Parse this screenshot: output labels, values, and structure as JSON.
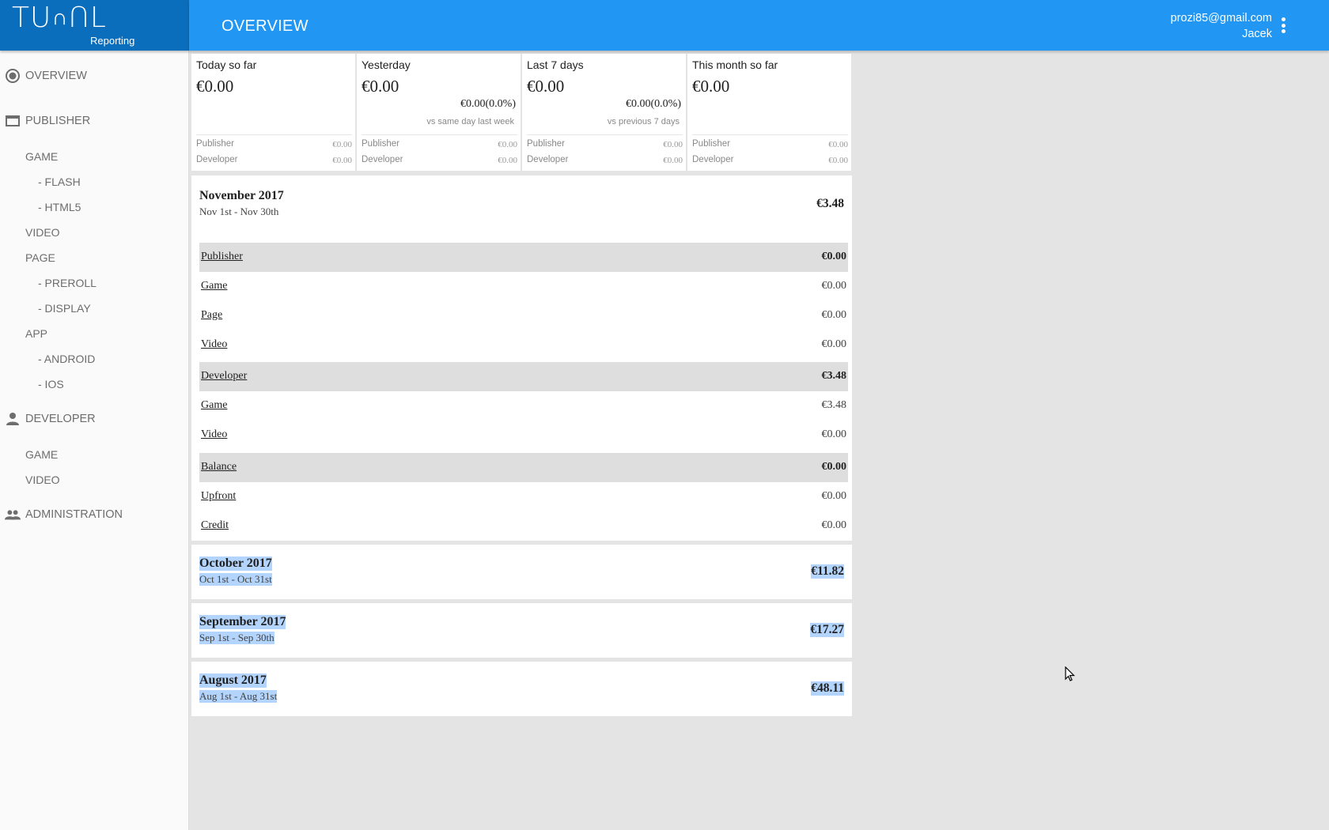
{
  "brand": {
    "logo": "TUՈՈL",
    "sub": "Reporting",
    "header_color": "#0a6ebd",
    "accent": "#2196f3"
  },
  "header": {
    "title": "OVERVIEW",
    "email": "prozi85@gmail.com",
    "user": "Jacek",
    "menu_icon": "more-vert-icon"
  },
  "sidebar": {
    "items": [
      {
        "label": "OVERVIEW",
        "icon": "radio-button-checked-icon",
        "level": 0
      },
      {
        "label": "PUBLISHER",
        "icon": "web-asset-icon",
        "level": 0
      },
      {
        "label": "GAME",
        "level": 1
      },
      {
        "label": "- FLASH",
        "level": 2
      },
      {
        "label": "- HTML5",
        "level": 2
      },
      {
        "label": "VIDEO",
        "level": 1
      },
      {
        "label": "PAGE",
        "level": 1
      },
      {
        "label": "- PREROLL",
        "level": 2
      },
      {
        "label": "- DISPLAY",
        "level": 2
      },
      {
        "label": "APP",
        "level": 1
      },
      {
        "label": "- ANDROID",
        "level": 2
      },
      {
        "label": "- IOS",
        "level": 2
      },
      {
        "label": "DEVELOPER",
        "icon": "person-icon",
        "level": 0
      },
      {
        "label": "GAME",
        "level": 1
      },
      {
        "label": "VIDEO",
        "level": 1
      },
      {
        "label": "ADMINISTRATION",
        "icon": "people-icon",
        "level": 0
      }
    ]
  },
  "cards": [
    {
      "title": "Today so far",
      "value": "€0.00",
      "compare": "",
      "compare_note": "",
      "publisher_label": "Publisher",
      "publisher": "€0.00",
      "developer_label": "Developer",
      "developer": "€0.00"
    },
    {
      "title": "Yesterday",
      "value": "€0.00",
      "compare": "€0.00(0.0%)",
      "compare_note": "vs same day last week",
      "publisher_label": "Publisher",
      "publisher": "€0.00",
      "developer_label": "Developer",
      "developer": "€0.00"
    },
    {
      "title": "Last 7 days",
      "value": "€0.00",
      "compare": "€0.00(0.0%)",
      "compare_note": "vs previous 7 days",
      "publisher_label": "Publisher",
      "publisher": "€0.00",
      "developer_label": "Developer",
      "developer": "€0.00"
    },
    {
      "title": "This month so far",
      "value": "€0.00",
      "compare": "",
      "compare_note": "",
      "publisher_label": "Publisher",
      "publisher": "€0.00",
      "developer_label": "Developer",
      "developer": "€0.00"
    }
  ],
  "months": [
    {
      "name": "November 2017",
      "range": "Nov 1st - Nov 30th",
      "total": "€3.48",
      "selected": false,
      "rows": [
        {
          "name": "Publisher",
          "value": "€0.00",
          "group": true
        },
        {
          "name": "Game",
          "value": "€0.00",
          "group": false
        },
        {
          "name": "Page",
          "value": "€0.00",
          "group": false
        },
        {
          "name": "Video",
          "value": "€0.00",
          "group": false
        },
        {
          "name": "Developer",
          "value": "€3.48",
          "group": true
        },
        {
          "name": "Game",
          "value": "€3.48",
          "group": false
        },
        {
          "name": "Video",
          "value": "€0.00",
          "group": false
        },
        {
          "name": "Balance",
          "value": "€0.00",
          "group": true
        },
        {
          "name": "Upfront",
          "value": "€0.00",
          "group": false
        },
        {
          "name": "Credit",
          "value": "€0.00",
          "group": false
        }
      ]
    },
    {
      "name": "October 2017",
      "range": "Oct 1st - Oct 31st",
      "total": "€11.82",
      "selected": true
    },
    {
      "name": "September 2017",
      "range": "Sep 1st - Sep 30th",
      "total": "€17.27",
      "selected": true
    },
    {
      "name": "August 2017",
      "range": "Aug 1st - Aug 31st",
      "total": "€48.11",
      "selected": true
    }
  ]
}
